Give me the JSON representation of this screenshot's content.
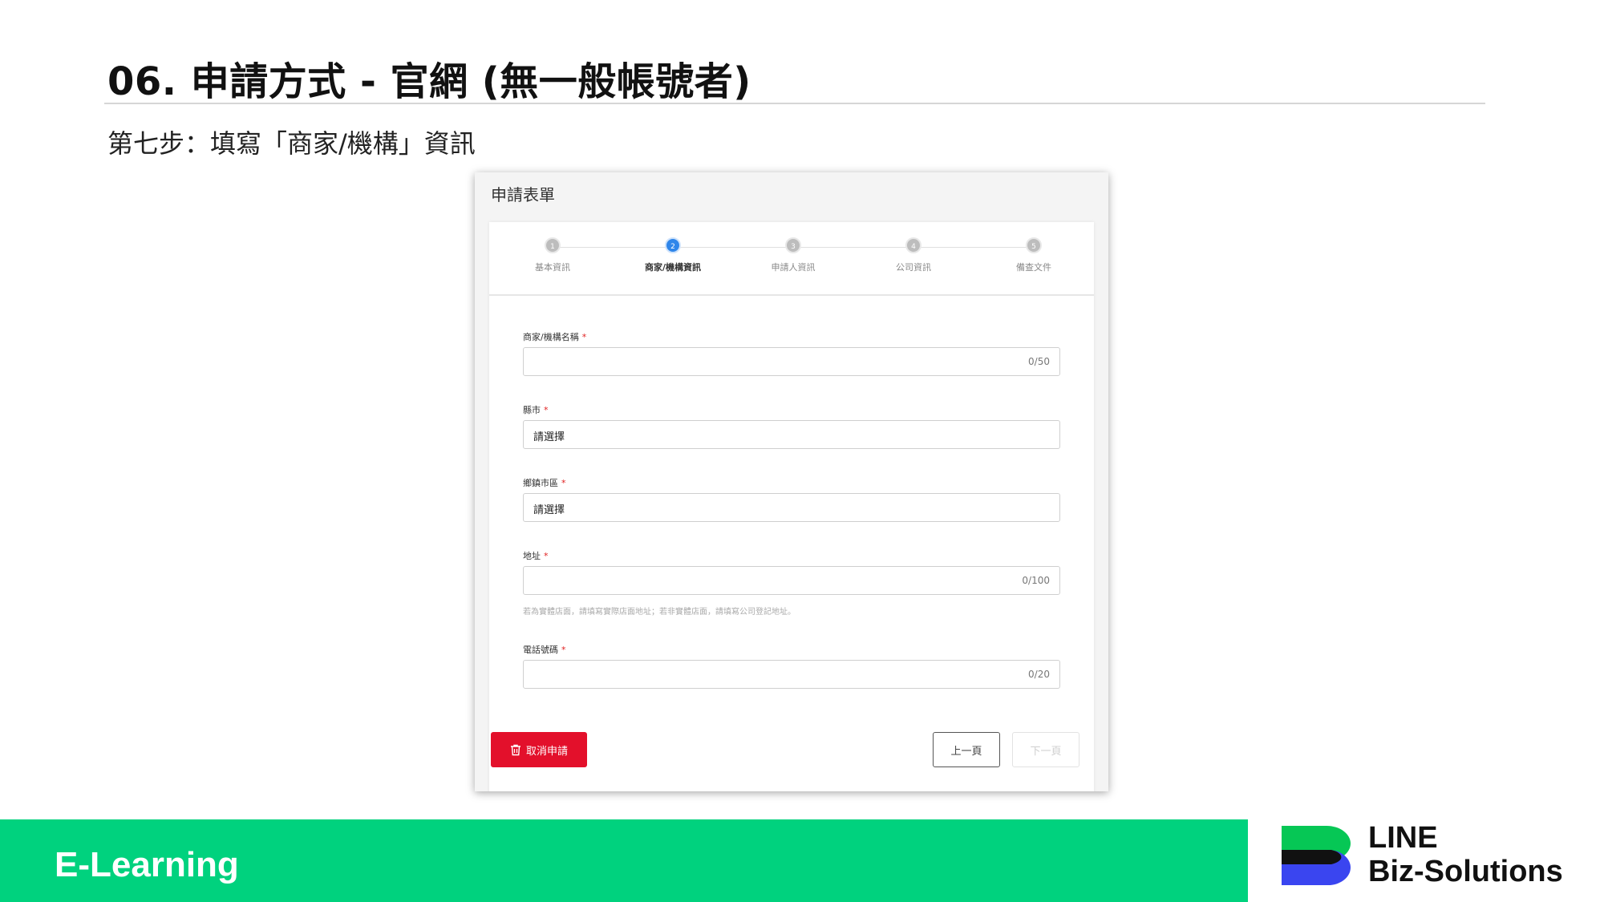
{
  "slide": {
    "title": "06. 申請方式 - 官網 (無一般帳號者)",
    "subtitle": "第七步：填寫「商家/機構」資訊"
  },
  "form": {
    "header": "申請表單",
    "steps": [
      {
        "number": "1",
        "label": "基本資訊"
      },
      {
        "number": "2",
        "label": "商家/機構資訊"
      },
      {
        "number": "3",
        "label": "申請人資訊"
      },
      {
        "number": "4",
        "label": "公司資訊"
      },
      {
        "number": "5",
        "label": "備查文件"
      }
    ],
    "active_step": 2,
    "fields": {
      "name": {
        "label": "商家/機構名稱",
        "required": "*",
        "counter": "0/50"
      },
      "city": {
        "label": "縣市",
        "required": "*",
        "value": "請選擇"
      },
      "district": {
        "label": "鄉鎮市區",
        "required": "*",
        "value": "請選擇"
      },
      "address": {
        "label": "地址",
        "required": "*",
        "counter": "0/100",
        "hint": "若為實體店面，請填寫實際店面地址；若非實體店面，請填寫公司登記地址。"
      },
      "phone": {
        "label": "電話號碼",
        "required": "*",
        "counter": "0/20"
      }
    },
    "buttons": {
      "cancel": "取消申請",
      "prev": "上一頁",
      "next": "下一頁"
    }
  },
  "footer": {
    "course": "E-Learning",
    "brand_line1": "LINE",
    "brand_line2": "Biz-Solutions"
  },
  "colors": {
    "accent_green": "#00d27e",
    "step_active": "#2f86ea",
    "cancel_red": "#e3102b",
    "logo_green": "#06c755",
    "logo_blue": "#3a45f0"
  }
}
